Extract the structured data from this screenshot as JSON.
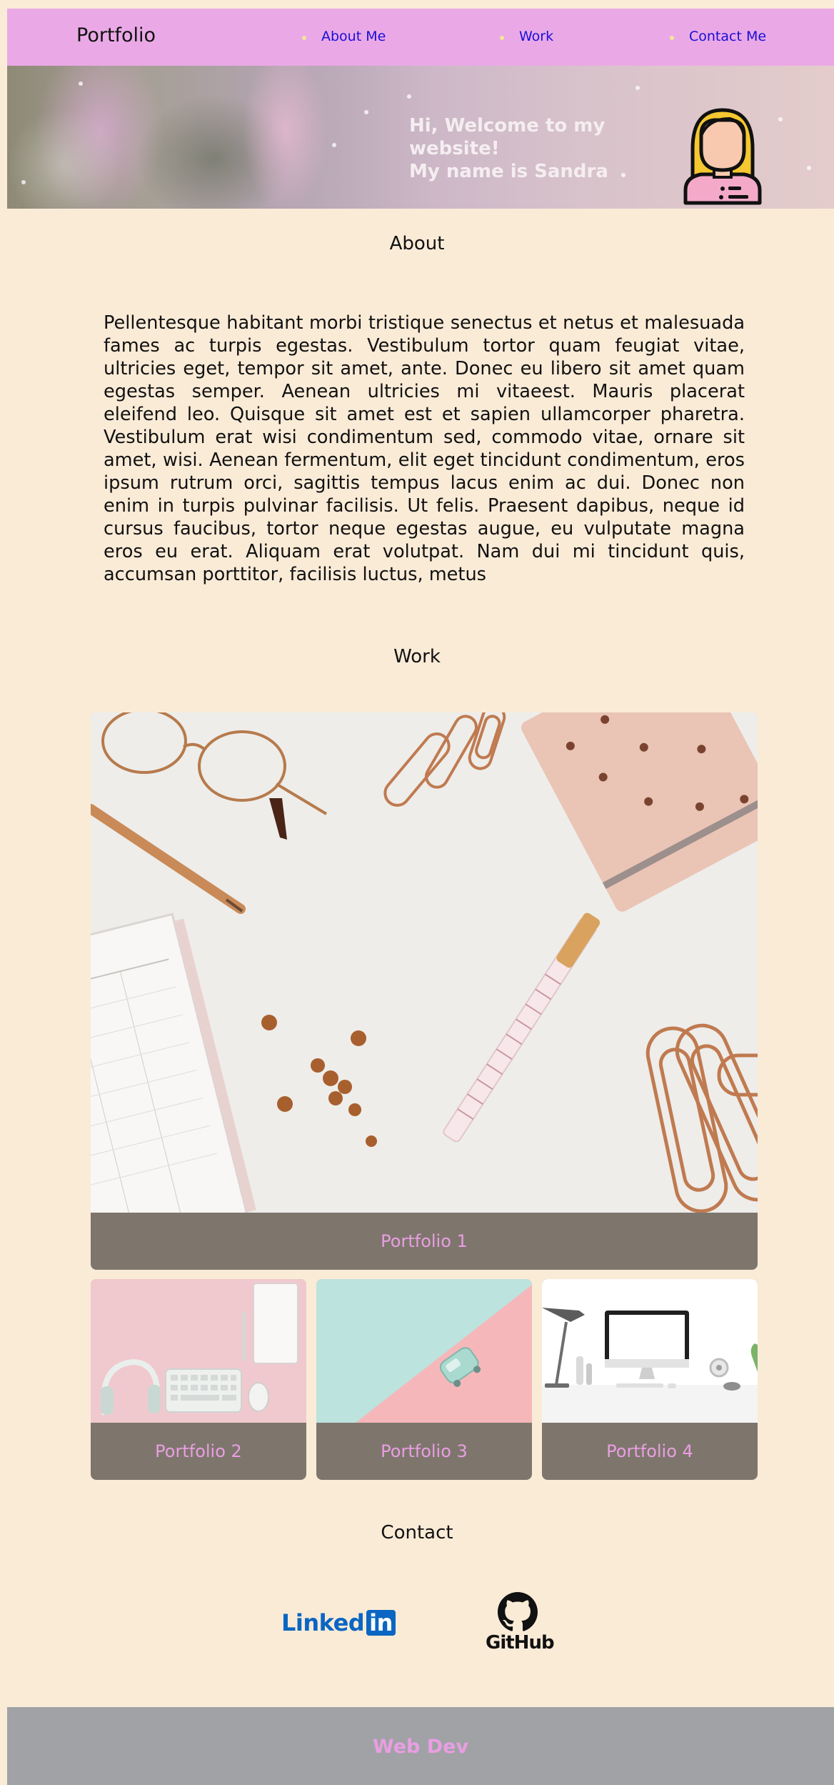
{
  "header": {
    "brand": "Portfolio",
    "nav": [
      {
        "label": "About Me"
      },
      {
        "label": "Work"
      },
      {
        "label": "Contact Me"
      }
    ]
  },
  "hero": {
    "lines": [
      "Hi, Welcome to my",
      "website!",
      "My name is Sandra"
    ]
  },
  "about": {
    "title": "About",
    "paragraph": "Pellentesque habitant morbi tristique senectus et netus et malesuada fames ac turpis egestas. Vestibulum tortor quam feugiat vitae, ultricies eget, tempor sit amet, ante. Donec eu libero sit amet quam egestas semper. Aenean ultricies mi vitaeest. Mauris placerat eleifend leo. Quisque sit amet est et sapien ullamcorper pharetra. Vestibulum erat wisi condimentum sed, commodo vitae, ornare sit amet, wisi. Aenean fermentum, elit eget tincidunt condimentum, eros ipsum rutrum orci, sagittis tempus lacus enim ac dui. Donec non enim in turpis pulvinar facilisis. Ut felis. Praesent dapibus, neque id cursus faucibus, tortor neque egestas augue, eu vulputate magna eros eu erat. Aliquam erat volutpat. Nam dui mi tincidunt quis, accumsan porttitor, facilisis luctus, metus"
  },
  "work": {
    "title": "Work",
    "items": [
      {
        "caption": "Portfolio 1"
      },
      {
        "caption": "Portfolio 2"
      },
      {
        "caption": "Portfolio 3"
      },
      {
        "caption": "Portfolio 4"
      }
    ]
  },
  "contact": {
    "title": "Contact",
    "linkedin_text": "Linked",
    "linkedin_box": "in",
    "github_label": "GitHub"
  },
  "footer": {
    "text": "Web Dev"
  },
  "colors": {
    "background": "#FAEBD7",
    "header": "#EAA9E6",
    "nav_link": "#1A0DD8",
    "caption_bg": "#7E766D",
    "caption_text": "#E99EE2",
    "footer": "#A0A2A5",
    "linkedin": "#0A66C2"
  }
}
